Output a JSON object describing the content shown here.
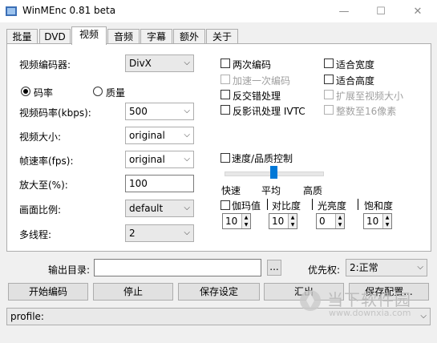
{
  "window": {
    "title": "WinMEnc 0.81 beta",
    "minimize": "—",
    "maximize": "☐",
    "close": "✕"
  },
  "tabs": [
    "批量",
    "DVD",
    "视频",
    "音频",
    "字幕",
    "额外",
    "关于"
  ],
  "left": {
    "encoder_label": "视频编码器:",
    "encoder_value": "DivX",
    "radio_bitrate": "码率",
    "radio_quality": "质量",
    "bitrate_label": "视频码率(kbps):",
    "bitrate_value": "500",
    "size_label": "视频大小:",
    "size_value": "original",
    "fps_label": "帧速率(fps):",
    "fps_value": "original",
    "scale_label": "放大至(%):",
    "scale_value": "100",
    "aspect_label": "画面比例:",
    "aspect_value": "default",
    "threads_label": "多线程:",
    "threads_value": "2"
  },
  "options": {
    "two_pass": "两次编码",
    "fast_first_pass": "加速一次编码",
    "deinterlace": "反交错处理",
    "ivtc": "反影讯处理 IVTC",
    "fit_width": "适合宽度",
    "fit_height": "适合高度",
    "expand_to_video": "扩展至视频大小",
    "mod16": "整数至16像素"
  },
  "speed_quality": {
    "label": "速度/品质控制",
    "fast": "快速",
    "balanced": "平均",
    "quality": "高质",
    "level": 0.5
  },
  "color": {
    "gamma_label": "伽玛值",
    "contrast_label": "对比度",
    "brightness_label": "光亮度",
    "saturation_label": "饱和度",
    "gamma": "10",
    "contrast": "10",
    "brightness": "0",
    "saturation": "10"
  },
  "bottom": {
    "output_label": "输出目录:",
    "output_value": "",
    "browse": "...",
    "priority_label": "优先权:",
    "priority_value": "2:正常",
    "start": "开始编码",
    "stop": "停止",
    "save_settings": "保存设定",
    "export": "汇出",
    "save_config": "保存配置...",
    "profile_value": "profile:"
  },
  "watermark": {
    "line1": "当下软件园",
    "line2": "www.downxia.com"
  },
  "colors": {
    "accent": "#0078d7"
  }
}
